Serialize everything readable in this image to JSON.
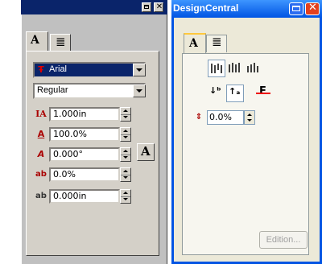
{
  "left_palette": {
    "tabs": [
      {
        "icon": "character-tab-icon",
        "label": "A"
      },
      {
        "icon": "paragraph-tab-icon",
        "label": "≣"
      }
    ],
    "font": {
      "value": "Arial"
    },
    "style": {
      "value": "Regular"
    },
    "fields": [
      {
        "icon": "font-size-icon",
        "value": "1.000in"
      },
      {
        "icon": "width-scale-icon",
        "value": "100.0%"
      },
      {
        "icon": "obliquing-icon",
        "value": "0.000°"
      },
      {
        "icon": "tracking-icon",
        "value": "0.0%"
      },
      {
        "icon": "baseline-offset-icon",
        "value": "0.000in"
      }
    ],
    "icon_glyphs": {
      "font_size": "IA",
      "width": "A",
      "oblique": "A",
      "tracking": "ab",
      "baseline": "ab"
    },
    "side_button_label": "A",
    "colors": {
      "title": "#0a246a",
      "panel": "#d4d0c8",
      "font_field_bg": "#0a246a"
    }
  },
  "right_palette": {
    "title": "DesignCentral",
    "tabs": [
      {
        "icon": "character-tab-icon",
        "label": "A"
      },
      {
        "icon": "paragraph-tab-icon",
        "label": "≣"
      }
    ],
    "field": {
      "icon": "line-spacing-icon",
      "value": "0.0%"
    },
    "button": {
      "label": "Edition..."
    },
    "colors": {
      "title": "#0054e3",
      "panel": "#ece9d8",
      "close": "#e3411f"
    }
  }
}
